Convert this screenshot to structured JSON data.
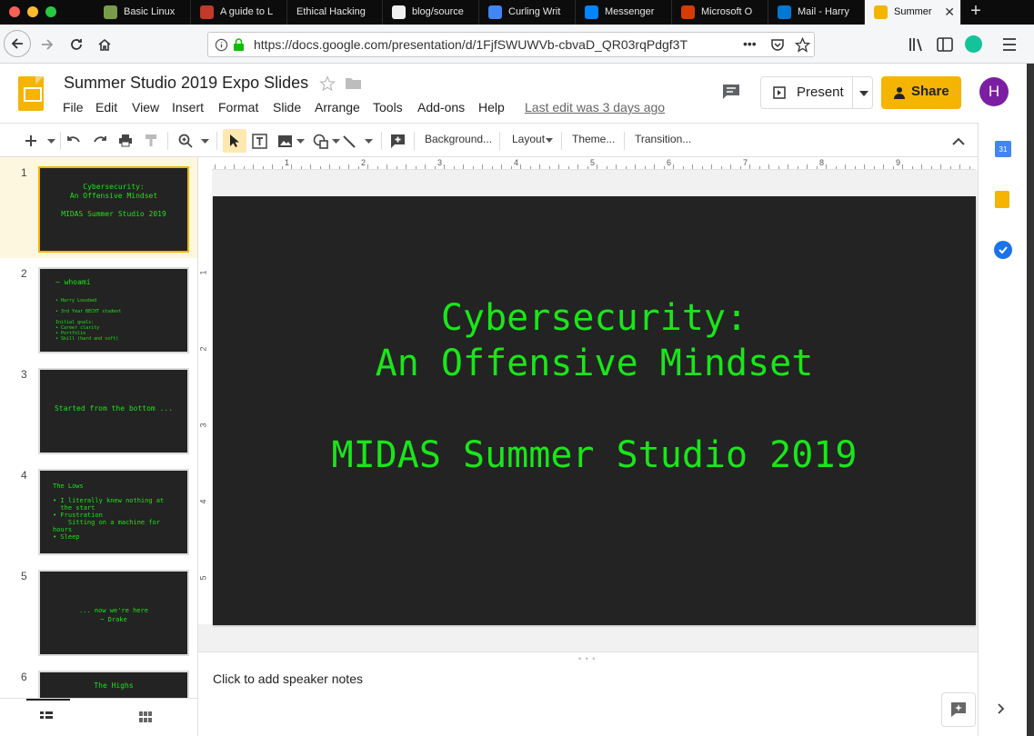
{
  "browser": {
    "tabs": [
      {
        "label": "Basic Linux",
        "color": "#7a9c4a"
      },
      {
        "label": "A guide to L",
        "color": "#c0392b"
      },
      {
        "label": "Ethical Hacking",
        "color": ""
      },
      {
        "label": "blog/source",
        "color": "#f0f0f0"
      },
      {
        "label": "Curling Writ",
        "color": "#4285f4"
      },
      {
        "label": "Messenger",
        "color": "#0084ff"
      },
      {
        "label": "Microsoft O",
        "color": "#d83b01"
      },
      {
        "label": "Mail - Harry",
        "color": "#0078d4"
      },
      {
        "label": "Summer",
        "color": "#f4b400",
        "active": true
      }
    ],
    "new_tab_icon": "+",
    "url": "https://docs.google.com/presentation/d/1FjfSWUWVb-cbvaD_QR03rqPdgf3T",
    "page_actions_icon": "•••"
  },
  "docs": {
    "title": "Summer Studio 2019 Expo Slides",
    "menu": [
      "File",
      "Edit",
      "View",
      "Insert",
      "Format",
      "Slide",
      "Arrange",
      "Tools",
      "Add-ons",
      "Help"
    ],
    "last_edit": "Last edit was 3 days ago",
    "present_label": "Present",
    "share_label": "Share",
    "avatar_letter": "H",
    "brand_color": "#f4b400",
    "avatar_color": "#7b1fa2"
  },
  "toolbar": {
    "background": "Background...",
    "layout": "Layout",
    "theme": "Theme...",
    "transition": "Transition..."
  },
  "ruler": {
    "h_marks": [
      "1",
      "2",
      "3",
      "4",
      "5",
      "6",
      "7",
      "8",
      "9"
    ],
    "v_marks": [
      "1",
      "2",
      "3",
      "4",
      "5"
    ]
  },
  "slides": [
    {
      "num": "1",
      "lines": [
        "Cybersecurity:",
        "An Offensive Mindset",
        "",
        "MIDAS Summer Studio 2019"
      ]
    },
    {
      "num": "2",
      "lines": [
        "~ whoami",
        "",
        "• Harry Lousbed",
        "",
        "• 3rd Year BECHT student",
        "",
        "Initial goals:",
        "• Career clarity",
        "• Portfolio",
        "• Skill (hard and soft)"
      ]
    },
    {
      "num": "3",
      "lines": [
        "Started from the bottom ..."
      ]
    },
    {
      "num": "4",
      "lines": [
        "The Lows",
        "",
        "• I literally knew nothing at",
        "  the start",
        "• Frustration",
        "    Sitting on a machine for",
        "hours",
        "• Sleep"
      ]
    },
    {
      "num": "5",
      "lines": [
        "... now we're here",
        "~ Drake"
      ]
    },
    {
      "num": "6",
      "lines": [
        "The Highs"
      ]
    }
  ],
  "main_slide": {
    "line1": "Cybersecurity:",
    "line2": "An Offensive Mindset",
    "line3": "MIDAS Summer Studio 2019",
    "text_color": "#19e619",
    "bg_color": "#232323"
  },
  "notes": {
    "placeholder": "Click to add speaker notes"
  }
}
